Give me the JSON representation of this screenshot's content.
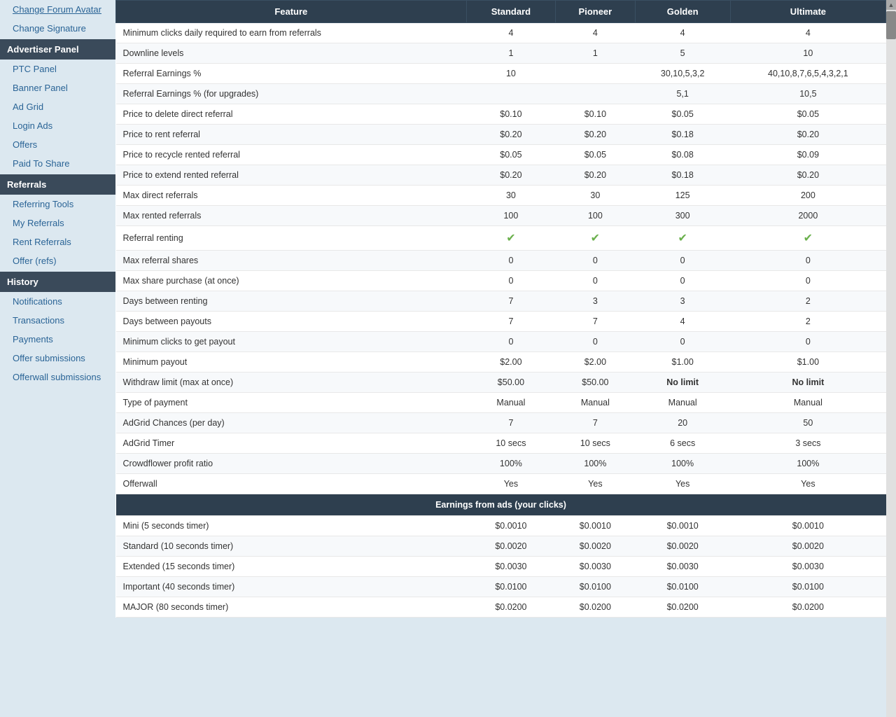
{
  "sidebar": {
    "top_links": [
      {
        "label": "Change Forum Avatar",
        "id": "change-forum-avatar"
      },
      {
        "label": "Change Signature",
        "id": "change-signature"
      }
    ],
    "sections": [
      {
        "header": "Advertiser Panel",
        "id": "advertiser-panel",
        "links": [
          {
            "label": "PTC Panel",
            "id": "ptc-panel"
          },
          {
            "label": "Banner Panel",
            "id": "banner-panel"
          },
          {
            "label": "Ad Grid",
            "id": "ad-grid"
          },
          {
            "label": "Login Ads",
            "id": "login-ads"
          },
          {
            "label": "Offers",
            "id": "offers"
          },
          {
            "label": "Paid To Share",
            "id": "paid-to-share"
          }
        ]
      },
      {
        "header": "Referrals",
        "id": "referrals",
        "links": [
          {
            "label": "Referring Tools",
            "id": "referring-tools"
          },
          {
            "label": "My Referrals",
            "id": "my-referrals"
          },
          {
            "label": "Rent Referrals",
            "id": "rent-referrals"
          },
          {
            "label": "Offer (refs)",
            "id": "offer-refs"
          }
        ]
      },
      {
        "header": "History",
        "id": "history",
        "links": [
          {
            "label": "Notifications",
            "id": "notifications"
          },
          {
            "label": "Transactions",
            "id": "transactions"
          },
          {
            "label": "Payments",
            "id": "payments"
          },
          {
            "label": "Offer submissions",
            "id": "offer-submissions"
          },
          {
            "label": "Offerwall submissions",
            "id": "offerwall-submissions"
          }
        ]
      }
    ]
  },
  "table": {
    "headers": [
      "Feature",
      "Standard",
      "Pioneer",
      "Golden",
      "Ultimate"
    ],
    "rows": [
      {
        "feature": "Minimum clicks daily required to earn from referrals",
        "standard": "4",
        "pioneer": "4",
        "golden": "4",
        "ultimate": "4"
      },
      {
        "feature": "Downline levels",
        "standard": "1",
        "pioneer": "1",
        "golden": "5",
        "ultimate": "10"
      },
      {
        "feature": "Referral Earnings %",
        "standard": "10",
        "pioneer": "",
        "golden": "30,10,5,3,2",
        "ultimate": "40,10,8,7,6,5,4,3,2,1",
        "standard_blue": true,
        "golden_blue": true,
        "ultimate_blue": true
      },
      {
        "feature": "Referral Earnings % (for upgrades)",
        "standard": "",
        "pioneer": "",
        "golden": "5,1",
        "ultimate": "10,5",
        "golden_blue": true,
        "ultimate_blue": true
      },
      {
        "feature": "Price to delete direct referral",
        "standard": "$0.10",
        "pioneer": "$0.10",
        "golden": "$0.05",
        "ultimate": "$0.05"
      },
      {
        "feature": "Price to rent referral",
        "standard": "$0.20",
        "pioneer": "$0.20",
        "golden": "$0.18",
        "ultimate": "$0.20"
      },
      {
        "feature": "Price to recycle rented referral",
        "standard": "$0.05",
        "pioneer": "$0.05",
        "golden": "$0.08",
        "ultimate": "$0.09"
      },
      {
        "feature": "Price to extend rented referral",
        "standard": "$0.20",
        "pioneer": "$0.20",
        "golden": "$0.18",
        "ultimate": "$0.20"
      },
      {
        "feature": "Max direct referrals",
        "standard": "30",
        "pioneer": "30",
        "golden": "125",
        "ultimate": "200"
      },
      {
        "feature": "Max rented referrals",
        "standard": "100",
        "pioneer": "100",
        "golden": "300",
        "ultimate": "2000"
      },
      {
        "feature": "Referral renting",
        "standard": "check",
        "pioneer": "check",
        "golden": "check",
        "ultimate": "check"
      },
      {
        "feature": "Max referral shares",
        "standard": "0",
        "pioneer": "0",
        "golden": "0",
        "ultimate": "0"
      },
      {
        "feature": "Max share purchase (at once)",
        "standard": "0",
        "pioneer": "0",
        "golden": "0",
        "ultimate": "0"
      },
      {
        "feature": "Days between renting",
        "standard": "7",
        "pioneer": "3",
        "golden": "3",
        "ultimate": "2"
      },
      {
        "feature": "Days between payouts",
        "standard": "7",
        "pioneer": "7",
        "golden": "4",
        "ultimate": "2"
      },
      {
        "feature": "Minimum clicks to get payout",
        "standard": "0",
        "pioneer": "0",
        "golden": "0",
        "ultimate": "0"
      },
      {
        "feature": "Minimum payout",
        "standard": "$2.00",
        "pioneer": "$2.00",
        "golden": "$1.00",
        "ultimate": "$1.00",
        "standard_blue": true,
        "pioneer_blue": true,
        "golden_blue": true,
        "ultimate_blue": true
      },
      {
        "feature": "Withdraw limit (max at once)",
        "standard": "$50.00",
        "pioneer": "$50.00",
        "golden": "No limit",
        "ultimate": "No limit",
        "golden_bold": true,
        "ultimate_bold": true
      },
      {
        "feature": "Type of payment",
        "standard": "Manual",
        "pioneer": "Manual",
        "golden": "Manual",
        "ultimate": "Manual"
      },
      {
        "feature": "AdGrid Chances (per day)",
        "standard": "7",
        "pioneer": "7",
        "golden": "20",
        "ultimate": "50"
      },
      {
        "feature": "AdGrid Timer",
        "standard": "10 secs",
        "pioneer": "10 secs",
        "golden": "6 secs",
        "ultimate": "3 secs"
      },
      {
        "feature": "Crowdflower profit ratio",
        "standard": "100%",
        "pioneer": "100%",
        "golden": "100%",
        "ultimate": "100%"
      },
      {
        "feature": "Offerwall",
        "standard": "Yes",
        "pioneer": "Yes",
        "golden": "Yes",
        "ultimate": "Yes"
      }
    ],
    "earnings_section_label": "Earnings from ads (your clicks)",
    "earnings_rows": [
      {
        "feature": "Mini (5 seconds timer)",
        "standard": "$0.0010",
        "pioneer": "$0.0010",
        "golden": "$0.0010",
        "ultimate": "$0.0010"
      },
      {
        "feature": "Standard (10 seconds timer)",
        "standard": "$0.0020",
        "pioneer": "$0.0020",
        "golden": "$0.0020",
        "ultimate": "$0.0020"
      },
      {
        "feature": "Extended (15 seconds timer)",
        "standard": "$0.0030",
        "pioneer": "$0.0030",
        "golden": "$0.0030",
        "ultimate": "$0.0030"
      },
      {
        "feature": "Important (40 seconds timer)",
        "standard": "$0.0100",
        "pioneer": "$0.0100",
        "golden": "$0.0100",
        "ultimate": "$0.0100"
      },
      {
        "feature": "MAJOR (80 seconds timer)",
        "standard": "$0.0200",
        "pioneer": "$0.0200",
        "golden": "$0.0200",
        "ultimate": "$0.0200"
      }
    ]
  },
  "icons": {
    "check": "✔",
    "scrollbar_up": "▲"
  }
}
